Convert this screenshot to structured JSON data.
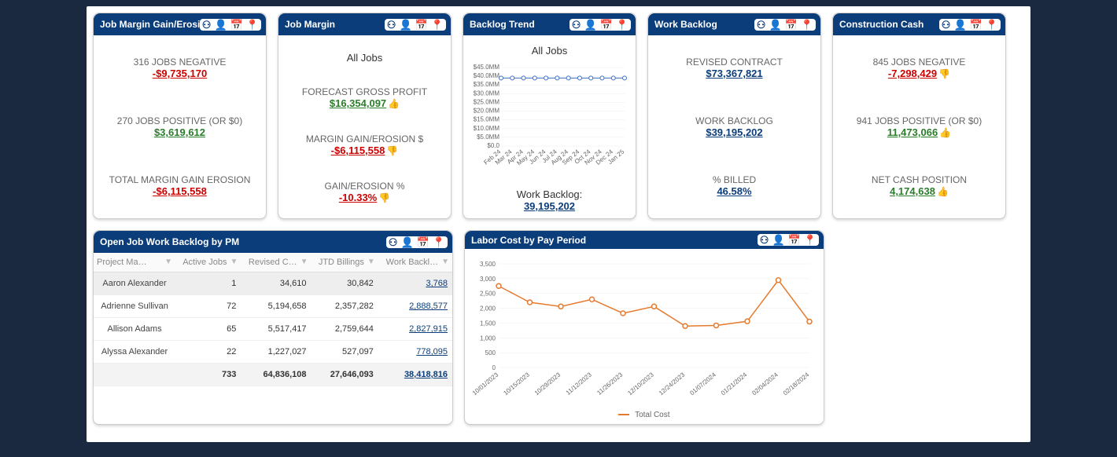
{
  "cards": {
    "jmge": {
      "title": "Job Margin Gain/Erosion",
      "m1_label": "316 JOBS NEGATIVE",
      "m1_value": "-$9,735,170",
      "m2_label": "270 JOBS POSITIVE (OR $0)",
      "m2_value": "$3,619,612",
      "m3_label": "TOTAL MARGIN GAIN EROSION",
      "m3_value": "-$6,115,558"
    },
    "jm": {
      "title": "Job Margin",
      "subtitle": "All Jobs",
      "m1_label": "FORECAST GROSS PROFIT",
      "m1_value": "$16,354,097",
      "m2_label": "MARGIN GAIN/EROSION $",
      "m2_value": "-$6,115,558",
      "m3_label": "GAIN/EROSION %",
      "m3_value": "-10.33%"
    },
    "bt": {
      "title": "Backlog Trend",
      "subtitle": "All Jobs",
      "summary_label": "Work Backlog:",
      "summary_value": "39,195,202"
    },
    "wb": {
      "title": "Work Backlog",
      "m1_label": "REVISED CONTRACT",
      "m1_value": "$73,367,821",
      "m2_label": "WORK BACKLOG",
      "m2_value": "$39,195,202",
      "m3_label": "% BILLED",
      "m3_value": "46.58%"
    },
    "cc": {
      "title": "Construction Cash",
      "m1_label": "845 JOBS NEGATIVE",
      "m1_value": "-7,298,429",
      "m2_label": "941 JOBS POSITIVE (OR $0)",
      "m2_value": "11,473,066",
      "m3_label": "NET CASH POSITION",
      "m3_value": "4,174,638"
    },
    "pm": {
      "title": "Open Job Work Backlog by PM",
      "cols": {
        "c0": "Project Ma…",
        "c1": "Active Jobs",
        "c2": "Revised C…",
        "c3": "JTD Billings",
        "c4": "Work Backl…"
      },
      "rows": [
        {
          "pm": "Aaron Alexander",
          "jobs": "1",
          "rev": "34,610",
          "jtd": "30,842",
          "wb": "3,768"
        },
        {
          "pm": "Adrienne Sullivan",
          "jobs": "72",
          "rev": "5,194,658",
          "jtd": "2,357,282",
          "wb": "2,888,577"
        },
        {
          "pm": "Allison Adams",
          "jobs": "65",
          "rev": "5,517,417",
          "jtd": "2,759,644",
          "wb": "2,827,915"
        },
        {
          "pm": "Alyssa Alexander",
          "jobs": "22",
          "rev": "1,227,027",
          "jtd": "527,097",
          "wb": "778,095"
        }
      ],
      "totals": {
        "jobs": "733",
        "rev": "64,836,108",
        "jtd": "27,646,093",
        "wb": "38,418,816"
      }
    },
    "lc": {
      "title": "Labor Cost by Pay Period",
      "legend": "Total Cost"
    }
  },
  "chart_data": [
    {
      "id": "backlog_trend",
      "type": "line",
      "title": "All Jobs",
      "xlabel": "",
      "ylabel": "",
      "ylim": [
        0,
        45
      ],
      "y_unit": "$MM",
      "y_ticks": [
        "$0.0",
        "$5.0MM",
        "$10.0MM",
        "$15.0MM",
        "$20.0MM",
        "$25.0MM",
        "$30.0MM",
        "$35.0MM",
        "$40.0MM",
        "$45.0MM"
      ],
      "categories": [
        "Feb 24",
        "Mar 24",
        "Apr 24",
        "May 24",
        "Jun 24",
        "Jul 24",
        "Aug 24",
        "Sep 24",
        "Oct 24",
        "Nov 24",
        "Dec 24",
        "Jan 25"
      ],
      "series": [
        {
          "name": "Work Backlog",
          "values": [
            39,
            39,
            39,
            39,
            39,
            39,
            39,
            39,
            39,
            39,
            39,
            39
          ]
        }
      ]
    },
    {
      "id": "labor_cost",
      "type": "line",
      "title": "Labor Cost by Pay Period",
      "xlabel": "",
      "ylabel": "",
      "ylim": [
        0,
        3500
      ],
      "y_ticks": [
        "0",
        "500",
        "1,000",
        "1,500",
        "2,000",
        "2,500",
        "3,000",
        "3,500"
      ],
      "categories": [
        "10/01/2023",
        "10/15/2023",
        "10/29/2023",
        "11/12/2023",
        "11/26/2023",
        "12/10/2023",
        "12/24/2023",
        "01/07/2024",
        "01/21/2024",
        "02/04/2024",
        "02/18/2024"
      ],
      "series": [
        {
          "name": "Total Cost",
          "values": [
            2750,
            2200,
            2060,
            2300,
            1830,
            2060,
            1400,
            1420,
            1560,
            2950,
            1550
          ]
        }
      ]
    }
  ]
}
